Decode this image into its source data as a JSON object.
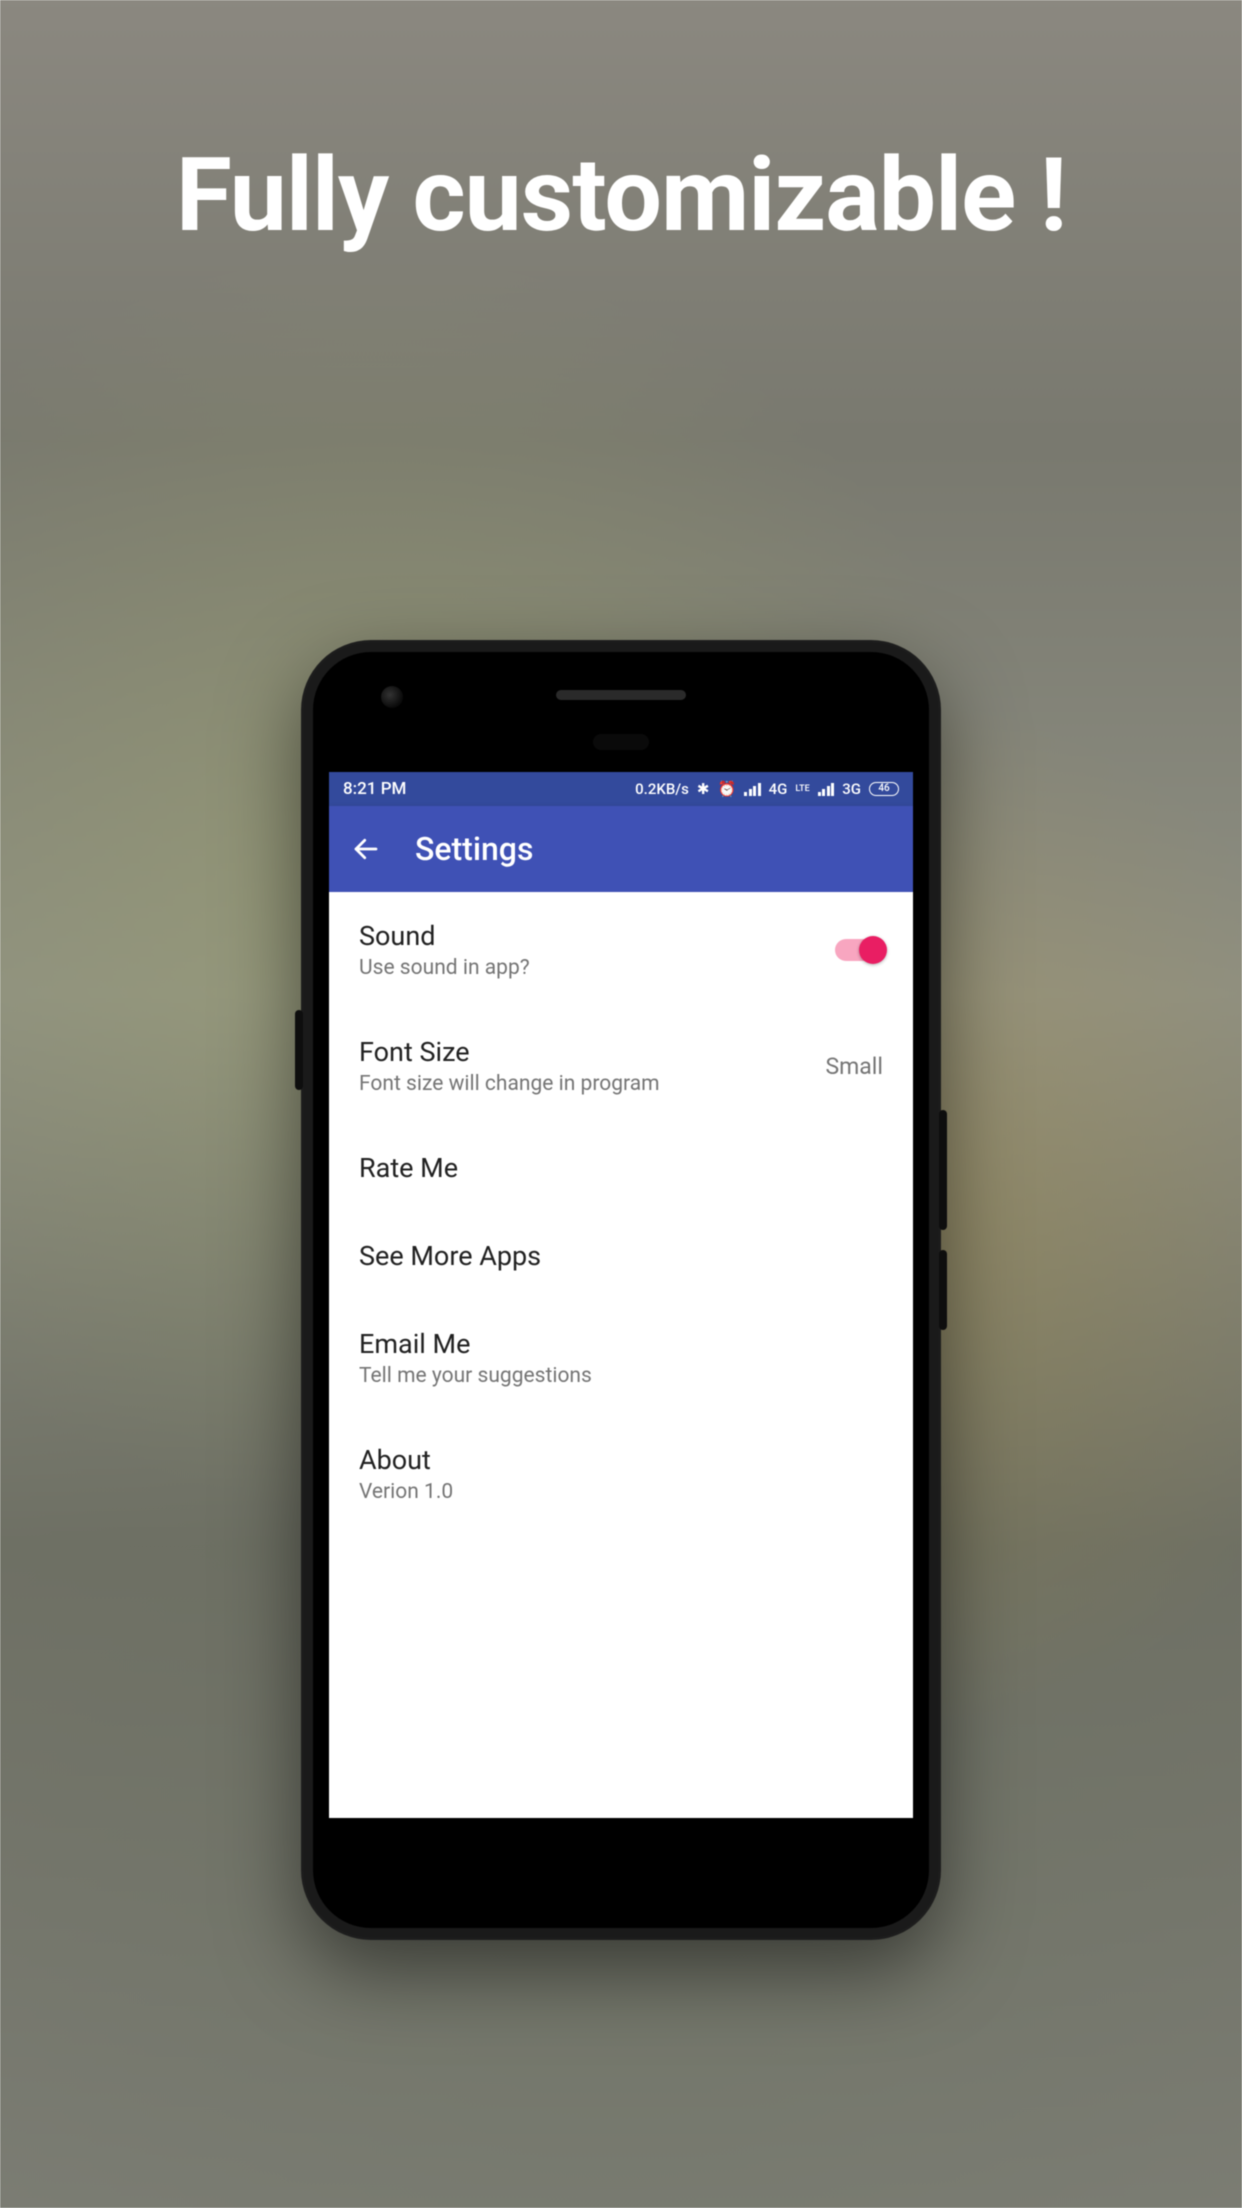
{
  "promo": {
    "headline": "Fully customizable !"
  },
  "statusbar": {
    "time": "8:21 PM",
    "speed": "0.2KB/s",
    "net1": "4G",
    "lte": "LTE",
    "net2": "3G",
    "battery": "46"
  },
  "appbar": {
    "title": "Settings"
  },
  "settings": {
    "sound": {
      "title": "Sound",
      "sub": "Use sound in app?",
      "enabled": true
    },
    "font": {
      "title": "Font Size",
      "sub": "Font size will change in program",
      "value": "Small"
    },
    "rate": {
      "title": "Rate Me"
    },
    "more": {
      "title": "See More Apps"
    },
    "email": {
      "title": "Email Me",
      "sub": "Tell me your suggestions"
    },
    "about": {
      "title": "About",
      "sub": "Verion 1.0"
    }
  }
}
